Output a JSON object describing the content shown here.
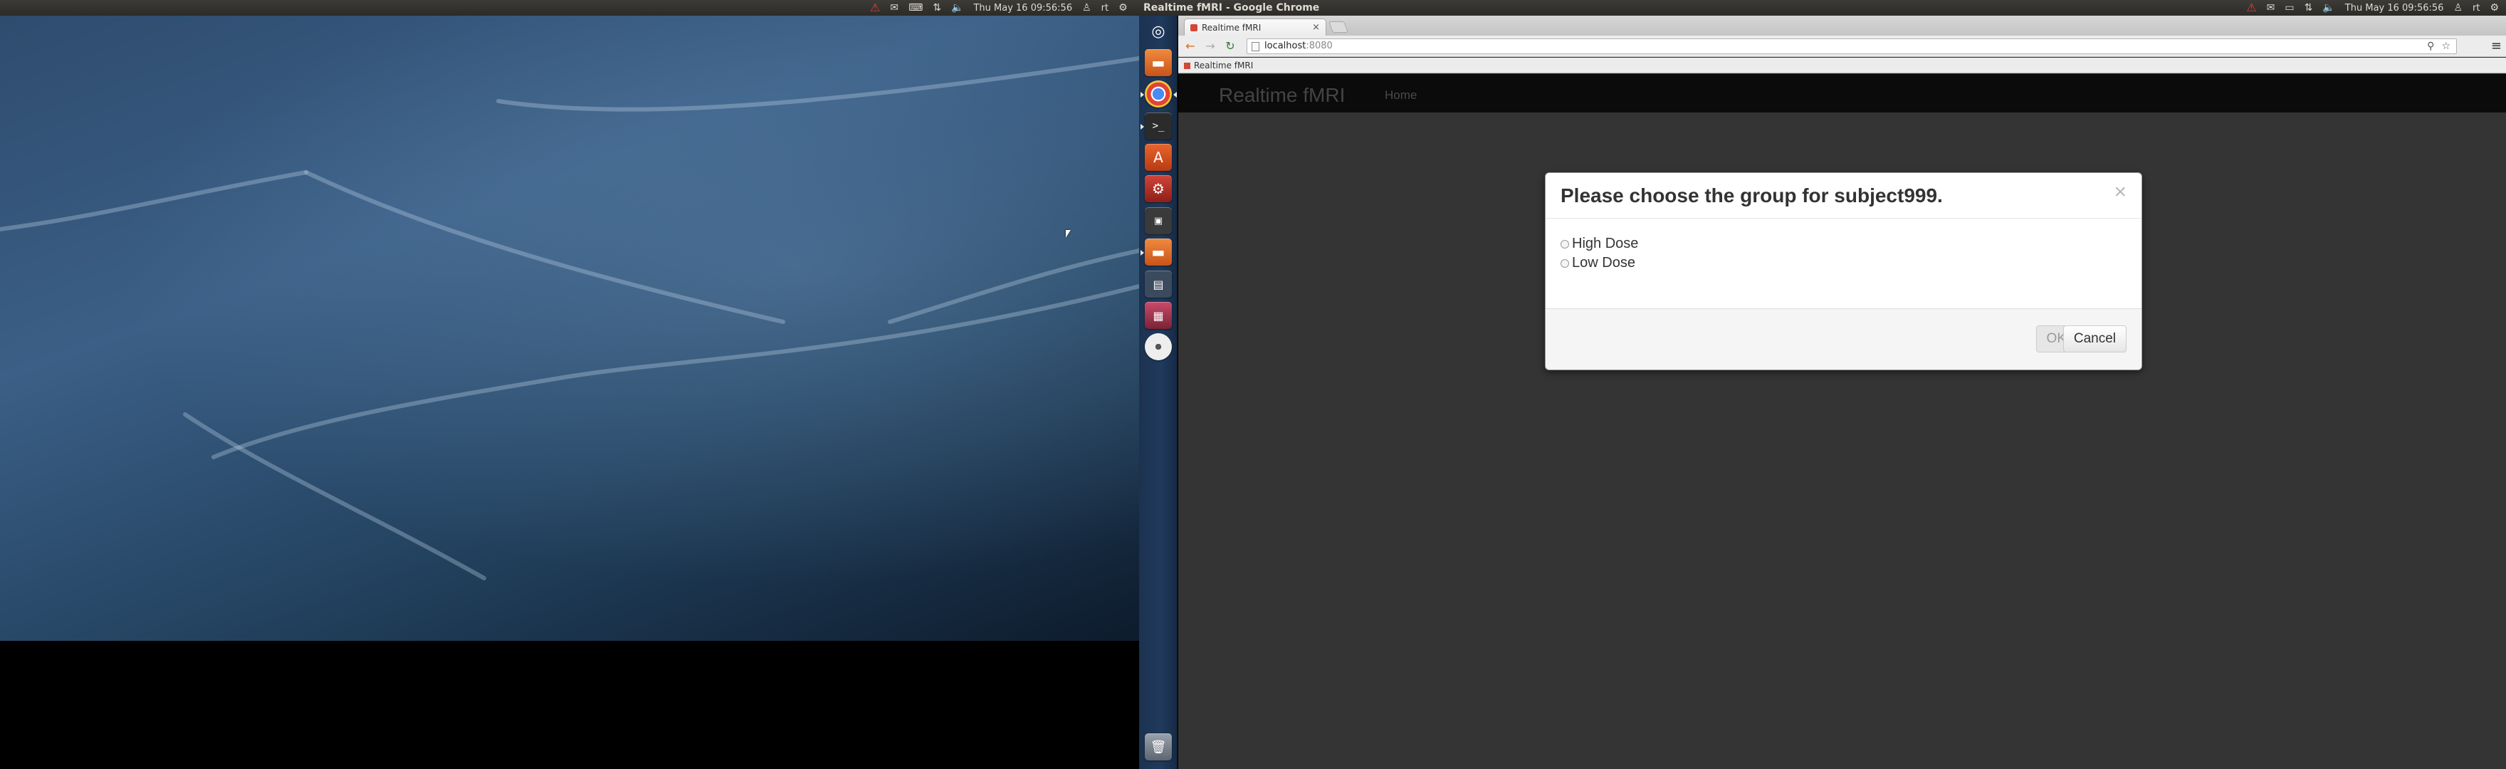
{
  "left_screen": {
    "panel": {
      "clock": "Thu May 16 09:56:56",
      "user": "rt",
      "indicators": [
        "warning-icon",
        "mail-icon",
        "keyboard-icon",
        "network-icon",
        "volume-icon"
      ]
    }
  },
  "right_screen": {
    "panel": {
      "window_title": "Realtime fMRI - Google Chrome",
      "clock": "Thu May 16 09:56:56",
      "user": "rt",
      "indicators": [
        "warning-icon",
        "mail-icon",
        "battery-icon",
        "network-icon",
        "volume-icon"
      ]
    },
    "launcher": {
      "items": [
        "dash-home",
        "files",
        "chrome",
        "terminal",
        "software-center",
        "system-settings",
        "terminal-2",
        "files-2",
        "workspace",
        "image-viewer",
        "disc",
        "trash"
      ]
    },
    "browser": {
      "tab_title": "Realtime fMRI",
      "url_host": "localhost",
      "url_port": ":8080",
      "bookmark_label": "Realtime fMRI"
    },
    "page": {
      "brand": "Realtime fMRI",
      "nav_home": "Home"
    },
    "modal": {
      "title": "Please choose the group for subject999.",
      "close_glyph": "×",
      "options": [
        {
          "label": "High Dose",
          "selected": false
        },
        {
          "label": "Low Dose",
          "selected": false
        }
      ],
      "ok_label": "OK",
      "ok_disabled": true,
      "cancel_label": "Cancel"
    }
  }
}
